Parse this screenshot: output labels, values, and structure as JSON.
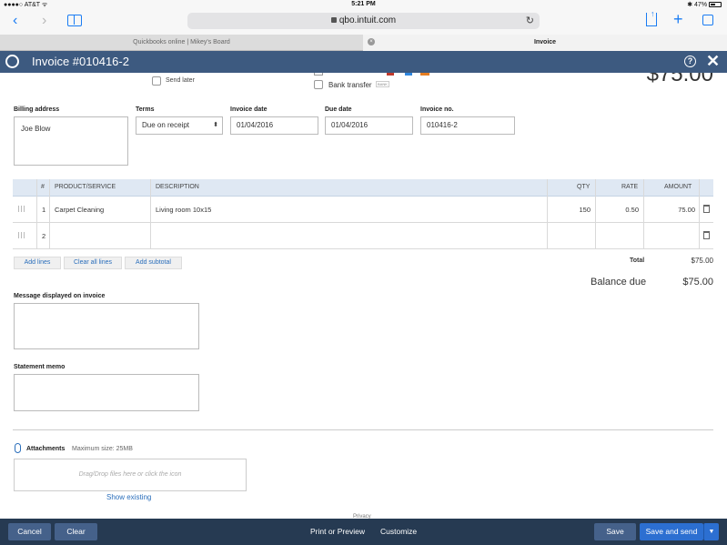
{
  "status_bar": {
    "carrier": "●●●●○ AT&T ᯤ",
    "time": "5:21 PM",
    "battery": "47%"
  },
  "browser": {
    "url": "qbo.intuit.com",
    "tabs": [
      {
        "label": "Quickbooks online | Mikey's Board"
      },
      {
        "label": "Invoice"
      }
    ]
  },
  "header": {
    "title": "Invoice #010416-2"
  },
  "top_options": {
    "send_later": "Send later",
    "bank_transfer": "Bank transfer",
    "bank_badge": "BANK",
    "amount_partial": "$75.00"
  },
  "form": {
    "billing_address_label": "Billing address",
    "billing_address_value": "Joe Blow",
    "terms_label": "Terms",
    "terms_value": "Due on receipt",
    "invoice_date_label": "Invoice date",
    "invoice_date_value": "01/04/2016",
    "due_date_label": "Due date",
    "due_date_value": "01/04/2016",
    "invoice_no_label": "Invoice no.",
    "invoice_no_value": "010416-2"
  },
  "table": {
    "headers": [
      "#",
      "PRODUCT/SERVICE",
      "DESCRIPTION",
      "QTY",
      "RATE",
      "AMOUNT"
    ],
    "rows": [
      {
        "num": "1",
        "product": "Carpet Cleaning",
        "description": "Living room 10x15",
        "qty": "150",
        "rate": "0.50",
        "amount": "75.00"
      },
      {
        "num": "2",
        "product": "",
        "description": "",
        "qty": "",
        "rate": "",
        "amount": ""
      }
    ]
  },
  "line_buttons": {
    "add_lines": "Add lines",
    "clear_all_lines": "Clear all lines",
    "add_subtotal": "Add subtotal"
  },
  "totals": {
    "total_label": "Total",
    "total_value": "$75.00",
    "balance_due_label": "Balance due",
    "balance_due_value": "$75.00"
  },
  "message": {
    "label": "Message displayed on invoice"
  },
  "memo": {
    "label": "Statement memo"
  },
  "attachments": {
    "label": "Attachments",
    "max_size": "Maximum size: 25MB",
    "dropzone_placeholder": "Drag/Drop files here or click the icon",
    "show_existing": "Show existing",
    "privacy": "Privacy"
  },
  "footer": {
    "cancel": "Cancel",
    "clear": "Clear",
    "print_preview": "Print or Preview",
    "customize": "Customize",
    "save": "Save",
    "save_and_send": "Save and send"
  },
  "colors": {
    "header_bg": "#3d5a80",
    "footer_bg": "#263a52",
    "link_blue": "#2a6ebb",
    "save_send_green_blue": "#2c6fd1"
  }
}
